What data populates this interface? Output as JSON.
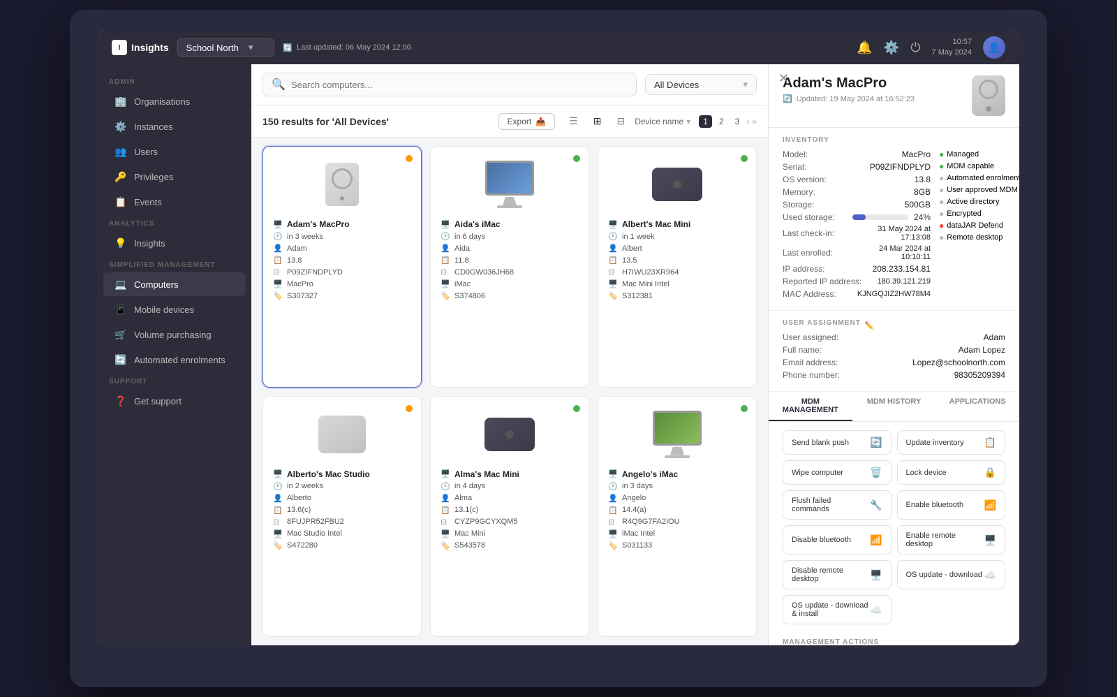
{
  "app": {
    "title": "Insights",
    "logo_text": "I"
  },
  "topbar": {
    "org": "School North",
    "last_updated": "Last updated: 06 May 2024 12:00",
    "time": "10:57",
    "date": "7 May 2024"
  },
  "sidebar": {
    "sections": [
      {
        "label": "ADMIN",
        "items": [
          {
            "id": "organisations",
            "label": "Organisations",
            "icon": "🏢"
          },
          {
            "id": "instances",
            "label": "Instances",
            "icon": "⚙️"
          },
          {
            "id": "users",
            "label": "Users",
            "icon": "👥"
          },
          {
            "id": "privileges",
            "label": "Privileges",
            "icon": "🔑"
          },
          {
            "id": "events",
            "label": "Events",
            "icon": "📋"
          }
        ]
      },
      {
        "label": "ANALYTICS",
        "items": [
          {
            "id": "insights",
            "label": "Insights",
            "icon": "💡"
          }
        ]
      },
      {
        "label": "SIMPLIFIED MANAGEMENT",
        "items": [
          {
            "id": "computers",
            "label": "Computers",
            "icon": "💻",
            "active": true
          },
          {
            "id": "mobile-devices",
            "label": "Mobile devices",
            "icon": "📱"
          },
          {
            "id": "volume-purchasing",
            "label": "Volume purchasing",
            "icon": "🛒"
          },
          {
            "id": "automated-enrolments",
            "label": "Automated enrolments",
            "icon": "🔄"
          }
        ]
      },
      {
        "label": "SUPPORT",
        "items": [
          {
            "id": "get-support",
            "label": "Get support",
            "icon": "❓"
          }
        ]
      }
    ]
  },
  "search": {
    "placeholder": "Search computers...",
    "filter": "All Devices"
  },
  "results": {
    "text": "150 results for 'All Devices'",
    "export_label": "Export",
    "sort_label": "Device name",
    "pagination": [
      "1",
      "2",
      "3"
    ]
  },
  "devices": [
    {
      "name": "Adam's MacPro",
      "time": "in 3 weeks",
      "user": "Adam",
      "os": "13.8",
      "serial": "P09ZIFNDPLYD",
      "model": "MacPro",
      "asset": "S307327",
      "status": "orange",
      "type": "mac_pro"
    },
    {
      "name": "Aida's iMac",
      "time": "in 6 days",
      "user": "Aida",
      "os": "11.8",
      "serial": "CD0GW036JH68",
      "model": "iMac",
      "asset": "S374806",
      "status": "green",
      "type": "imac"
    },
    {
      "name": "Albert's Mac Mini",
      "time": "in 1 week",
      "user": "Albert",
      "os": "13.5",
      "serial": "H7IWU23XR964",
      "model": "Mac Mini Intel",
      "asset": "S312381",
      "status": "green",
      "type": "mac_mini"
    },
    {
      "name": "Alberto's Mac Studio",
      "time": "in 2 weeks",
      "user": "Alberto",
      "os": "13.6(c)",
      "serial": "8FUJPR52FBU2",
      "model": "Mac Studio Intel",
      "asset": "S472280",
      "status": "orange",
      "type": "mac_studio"
    },
    {
      "name": "Alma's Mac Mini",
      "time": "in 4 days",
      "user": "Alma",
      "os": "13.1(c)",
      "serial": "CYZP9GCYXQM5",
      "model": "Mac Mini",
      "asset": "S543578",
      "status": "green",
      "type": "mac_mini"
    },
    {
      "name": "Angelo's iMac",
      "time": "in 3 days",
      "user": "Angelo",
      "os": "14.4(a)",
      "serial": "R4Q9G7FA2IOU",
      "model": "iMac Intel",
      "asset": "S031133",
      "status": "green",
      "type": "imac"
    }
  ],
  "detail": {
    "title": "Adam's MacPro",
    "updated": "Updated: 19 May 2024 at 16:52:23",
    "inventory": {
      "model": "MacPro",
      "serial": "P09ZIFNDPLYD",
      "os_version": "13.8",
      "memory": "8GB",
      "storage": "500GB",
      "used_storage_pct": 24,
      "used_storage_label": "24%",
      "last_checkin": "31 May 2024 at 17:13:08",
      "last_enrolled": "24 Mar 2024 at 10:10:11",
      "ip_address": "208.233.154.81",
      "reported_ip": "180.39.121.219",
      "mac_address": "KJNGQJIZ2HW78M4"
    },
    "status_items": [
      {
        "label": "Managed",
        "active": true
      },
      {
        "label": "MDM capable",
        "active": true
      },
      {
        "label": "Automated enrolment",
        "active": false
      },
      {
        "label": "User approved MDM",
        "active": false
      },
      {
        "label": "Active directory",
        "active": false
      },
      {
        "label": "Encrypted",
        "active": false
      },
      {
        "label": "dataJAR Defend",
        "active": "red"
      },
      {
        "label": "Remote desktop",
        "active": false
      }
    ],
    "user_assignment": {
      "user_assigned": "Adam",
      "full_name": "Adam Lopez",
      "email": "Lopez@schoolnorth.com",
      "phone": "98305209394"
    },
    "mdm_tabs": [
      "MDM MANAGEMENT",
      "MDM HISTORY",
      "APPLICATIONS"
    ],
    "mdm_actions": [
      {
        "label": "Send blank push",
        "icon": "🔄"
      },
      {
        "label": "Update inventory",
        "icon": "📋"
      },
      {
        "label": "Wipe computer",
        "icon": "🗑️"
      },
      {
        "label": "Lock device",
        "icon": "🔒"
      },
      {
        "label": "Flush failed commands",
        "icon": "🔧"
      },
      {
        "label": "Enable bluetooth",
        "icon": "📶"
      },
      {
        "label": "Disable bluetooth",
        "icon": "📶"
      },
      {
        "label": "Enable remote desktop",
        "icon": "🖥️"
      },
      {
        "label": "Disable remote desktop",
        "icon": "🖥️"
      },
      {
        "label": "OS update - download",
        "icon": "☁️"
      },
      {
        "label": "OS update - download & install",
        "icon": "☁️"
      }
    ],
    "management_actions_title": "MANAGEMENT ACTIONS"
  }
}
